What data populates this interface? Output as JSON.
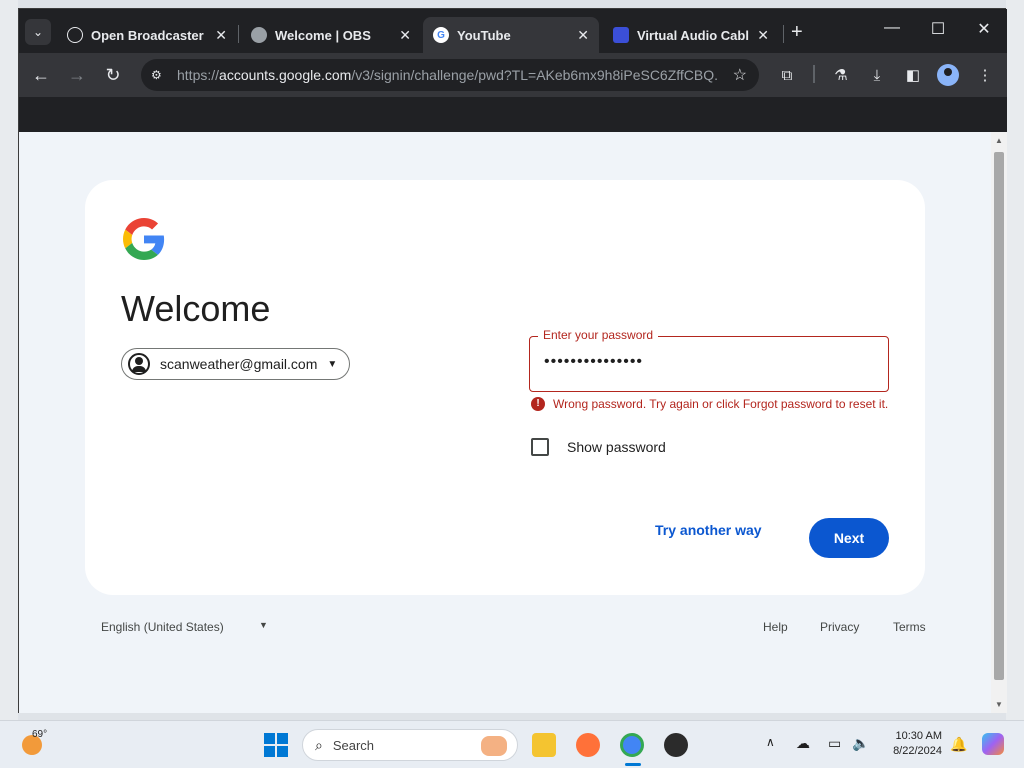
{
  "browser": {
    "tabs": [
      {
        "title": "Open Broadcaster Sc",
        "favicon": "obs-icon",
        "active": false
      },
      {
        "title": "Welcome | OBS",
        "favicon": "globe-icon",
        "active": false
      },
      {
        "title": "YouTube",
        "favicon": "google-g-icon",
        "active": true
      },
      {
        "title": "Virtual Audio Cable",
        "favicon": "vb-audio-icon",
        "active": false
      }
    ],
    "url_host": "accounts.google.com",
    "url_prefix": "https://",
    "url_path": "/v3/signin/challenge/pwd?TL=AKeb6mx9h8iPeSC6ZffCBQ..."
  },
  "signin": {
    "heading": "Welcome",
    "account_email": "scanweather@gmail.com",
    "password_label": "Enter your password",
    "password_masked": "•••••••••••••••",
    "error_message": "Wrong password. Try again or click Forgot password to reset it.",
    "show_password_label": "Show password",
    "try_another_label": "Try another way",
    "next_label": "Next"
  },
  "footer": {
    "language": "English (United States)",
    "help": "Help",
    "privacy": "Privacy",
    "terms": "Terms"
  },
  "taskbar": {
    "weather_temp": "69°",
    "search_label": "Search",
    "time": "10:30 AM",
    "date": "8/22/2024"
  },
  "colors": {
    "google_blue": "#0b57d0",
    "error_red": "#b3261e",
    "page_bg": "#f0f4f9"
  }
}
